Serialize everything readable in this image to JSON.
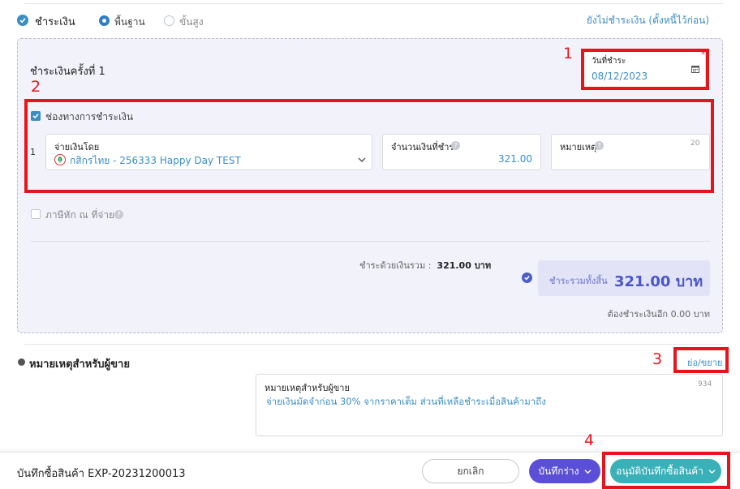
{
  "header": {
    "title": "ชำระเงิน",
    "mode_basic": "พื้นฐาน",
    "mode_advanced": "ขั้นสูง",
    "unpaid_link": "ยังไม่ชำระเงิน (ตั้งหนี้ไว้ก่อน)"
  },
  "payment": {
    "installment_title": "ชำระเงินครั้งที่ 1",
    "date_label": "วันที่ชำระ",
    "date_required": "*",
    "date_value": "08/12/2023",
    "channel_label": "ช่องทางการชำระเงิน",
    "row_number": "1",
    "paid_by_label": "จ่ายเงินโดย",
    "paid_by_value": "กสิกรไทย - 256333 Happy Day TEST",
    "amount_label": "จำนวนเงินที่ชำระ",
    "amount_value": "321.00",
    "note_label": "หมายเหตุ",
    "note_limit": "20",
    "withholding_label": "ภาษีหัก ณ ที่จ่าย",
    "help_glyph": "?",
    "cash_total_label": "ชำระด้วยเงินรวม :",
    "cash_total_value": "321.00 บาท",
    "grand_total_label": "ชำระรวมทั้งสิ้น",
    "grand_total_value": "321.00 บาท",
    "remaining": "ต้องชำระเงินอีก 0.00 บาท"
  },
  "seller_notes": {
    "heading": "หมายเหตุสำหรับผู้ขาย",
    "toggle": "ย่อ/ขยาย",
    "field_label": "หมายเหตุสำหรับผู้ขาย",
    "char_count": "934",
    "value": "จ่ายเงินมัดจำก่อน 30% จากราคาเต็ม ส่วนที่เหลือชำระเมื่อสินค้ามาถึง"
  },
  "footer": {
    "doc_title": "บันทึกซื้อสินค้า EXP-20231200013",
    "cancel_label": "ยกเลิก",
    "draft_label": "บันทึกร่าง",
    "approve_label": "อนุมัติบันทึกซื้อสินค้า"
  },
  "annotations": [
    "1",
    "2",
    "3",
    "4"
  ],
  "icons": {
    "check": "check-icon",
    "calendar": "calendar-icon",
    "bank": "kasikorn-bank-icon",
    "chevron": "chevron-down-icon",
    "help": "help-icon"
  },
  "colors": {
    "accent_blue": "#3a8ec6",
    "panel_bg": "#f2f2fb",
    "total_box": "#e2e3f7",
    "draft_button": "#5b4fd8",
    "approve_button": "#3ab0b8",
    "annotation_red": "#e8141b"
  }
}
